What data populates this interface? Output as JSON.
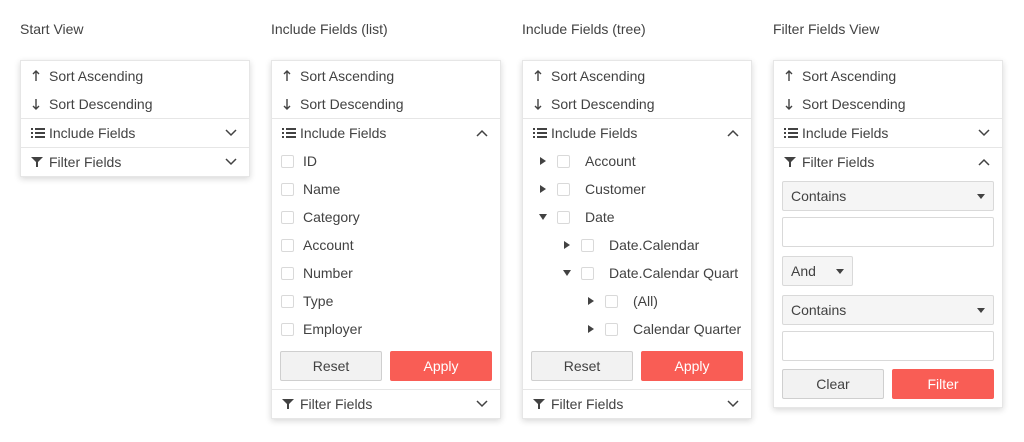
{
  "views": [
    {
      "title": "Start View"
    },
    {
      "title": "Include Fields (list)"
    },
    {
      "title": "Include Fields (tree)"
    },
    {
      "title": "Filter Fields View"
    }
  ],
  "menu": {
    "sort_ascending": "Sort Ascending",
    "sort_descending": "Sort Descending",
    "include_fields": "Include Fields",
    "filter_fields": "Filter Fields"
  },
  "list_fields": [
    "ID",
    "Name",
    "Category",
    "Account",
    "Number",
    "Type",
    "Employer"
  ],
  "tree_fields": [
    {
      "label": "Account",
      "level": 0,
      "expanded": false
    },
    {
      "label": "Customer",
      "level": 0,
      "expanded": false
    },
    {
      "label": "Date",
      "level": 0,
      "expanded": true
    },
    {
      "label": "Date.Calendar",
      "level": 1,
      "expanded": false
    },
    {
      "label": "Date.Calendar Quart",
      "level": 1,
      "expanded": true
    },
    {
      "label": "(All)",
      "level": 2,
      "expanded": false
    },
    {
      "label": "Calendar Quarter",
      "level": 2,
      "expanded": false
    }
  ],
  "buttons": {
    "reset": "Reset",
    "apply": "Apply",
    "clear": "Clear",
    "filter": "Filter"
  },
  "filter": {
    "operator1": "Contains",
    "value1": "",
    "logic": "And",
    "operator2": "Contains",
    "value2": ""
  },
  "colors": {
    "accent": "#f95d55",
    "text": "#424242",
    "border": "#e6e6e6"
  },
  "icons": {
    "sort_asc": "arrow-up-icon",
    "sort_desc": "arrow-down-icon",
    "include": "list-icon",
    "filter": "funnel-icon",
    "collapsed": "chevron-down-icon",
    "expanded": "chevron-up-icon"
  }
}
